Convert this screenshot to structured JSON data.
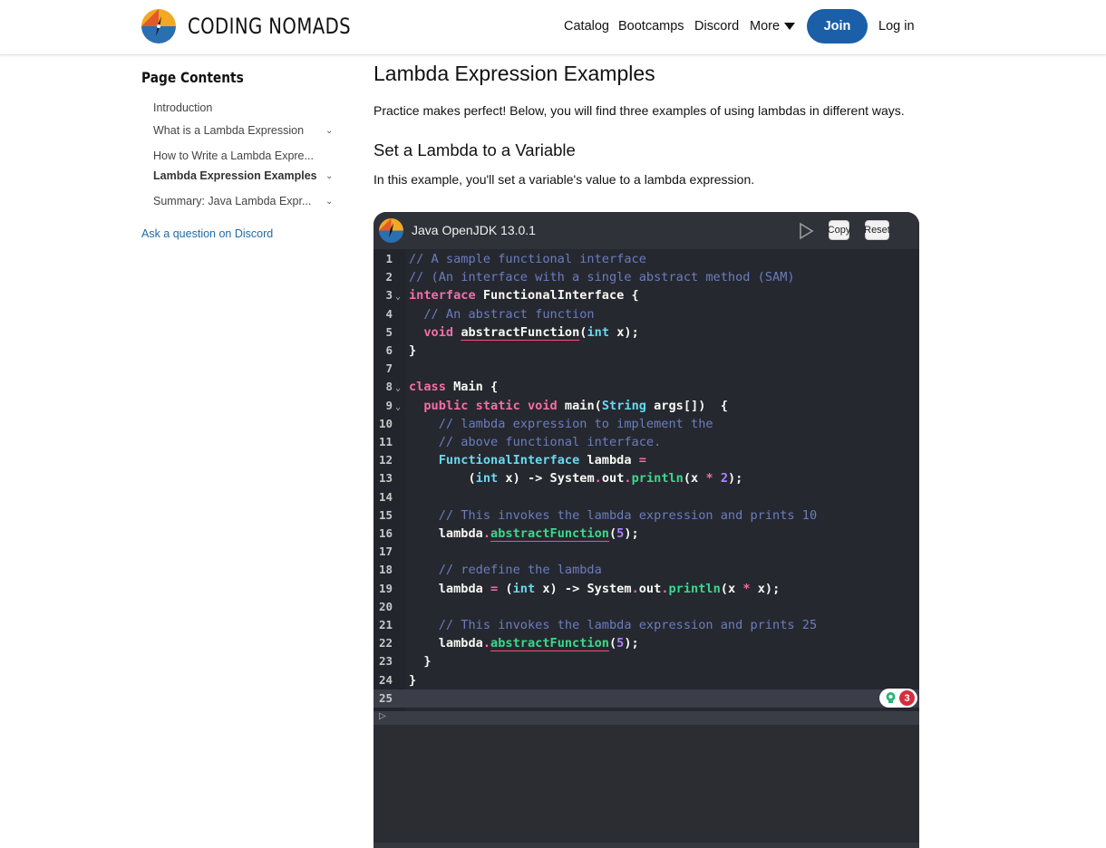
{
  "header": {
    "logo_text": "CODING NOMADS",
    "nav": {
      "catalog": "Catalog",
      "bootcamps": "Bootcamps",
      "discord": "Discord",
      "more": "More"
    },
    "join_label": "Join",
    "login_label": "Log in"
  },
  "sidebar": {
    "title": "Page Contents",
    "items": [
      {
        "label": "Introduction"
      },
      {
        "label": "What is a Lambda Expression"
      },
      {
        "label": "How to Write a Lambda Expre..."
      },
      {
        "label": "Lambda Expression Examples"
      },
      {
        "label": "Summary: Java Lambda Expr..."
      }
    ],
    "discord_link": "Ask a question on Discord"
  },
  "main": {
    "title": "Lambda Expression Examples",
    "intro": "Practice makes perfect! Below, you will find three examples of using lambdas in different ways.",
    "section_title": "Set a Lambda to a Variable",
    "section_text": "In this example, you'll set a variable's value to a lambda expression."
  },
  "widget": {
    "title": "Java OpenJDK 13.0.1",
    "copy_label": "Copy",
    "reset_label": "Reset",
    "active_line": 25,
    "issue_count": "3",
    "colors": {
      "background": "#282b33",
      "keyword": "#f36ea8",
      "type": "#66d9ef",
      "function": "#39d98a",
      "comment": "#6a7dbd",
      "error_underline": "#ff4f6d"
    },
    "code_lines": [
      "// A sample functional interface",
      "// (An interface with a single abstract method (SAM)",
      "interface FunctionalInterface {",
      "  // An abstract function",
      "  void abstractFunction(int x);",
      "}",
      "",
      "class Main {",
      "  public static void main(String args[])  {",
      "    // lambda expression to implement the",
      "    // above functional interface.",
      "    FunctionalInterface lambda =",
      "        (int x) -> System.out.println(x * 2);",
      "",
      "    // This invokes the lambda expression and prints 10",
      "    lambda.abstractFunction(5);",
      "",
      "    // redefine the lambda",
      "    lambda = (int x) -> System.out.println(x * x);",
      "",
      "    // This invokes the lambda expression and prints 25",
      "    lambda.abstractFunction(5);",
      "  }",
      "}",
      ""
    ]
  }
}
